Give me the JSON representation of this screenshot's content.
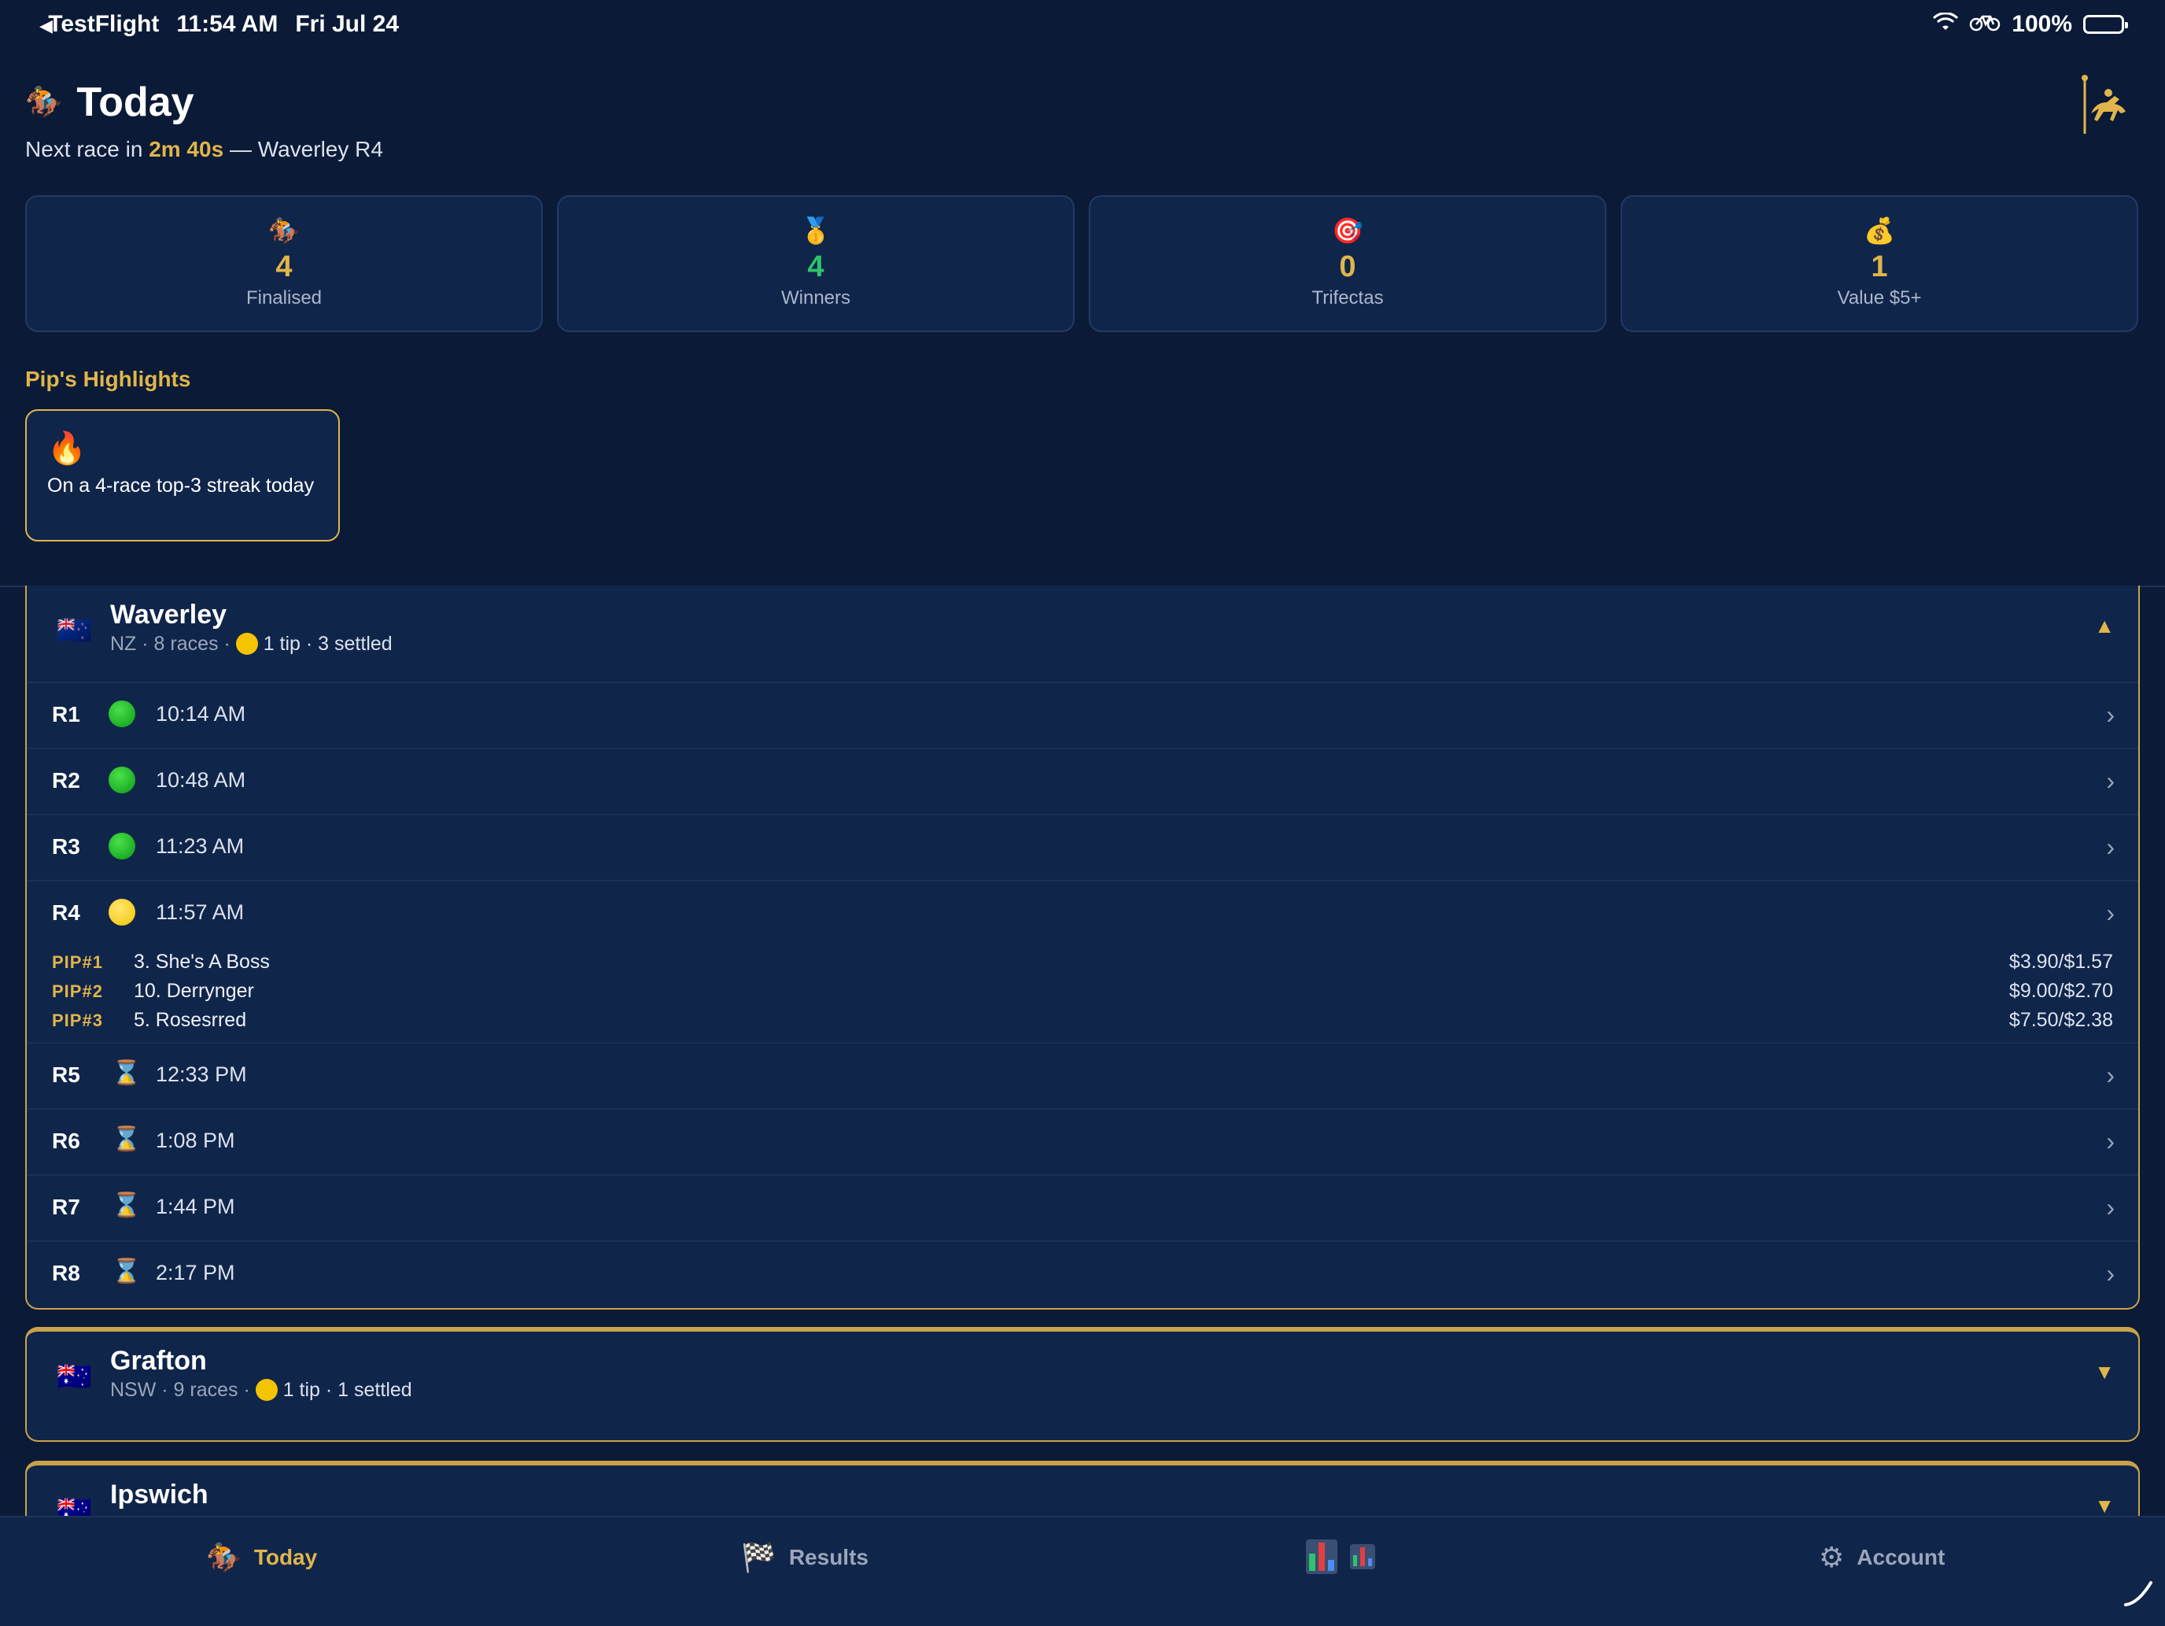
{
  "status_bar": {
    "back_app": "TestFlight",
    "time": "11:54 AM",
    "date": "Fri Jul 24",
    "battery": "100%"
  },
  "header": {
    "title": "Today",
    "subtitle_prefix": "Next race in",
    "countdown": "2m 40s",
    "subtitle_suffix": "— Waverley R4"
  },
  "stats": [
    {
      "icon": "🏇",
      "value": "4",
      "label": "Finalised",
      "color": "#e0b54b"
    },
    {
      "icon": "🥇",
      "value": "4",
      "label": "Winners",
      "color": "#2ec46a"
    },
    {
      "icon": "🎯",
      "value": "0",
      "label": "Trifectas",
      "color": "#e0b54b"
    },
    {
      "icon": "💰",
      "value": "1",
      "label": "Value $5+",
      "color": "#e0b54b"
    }
  ],
  "highlights": {
    "title": "Pip's Highlights",
    "items": [
      {
        "icon": "🔥",
        "text": "On a 4-race top-3 streak today"
      }
    ]
  },
  "venues": [
    {
      "name": "Waverley",
      "flag": "🇳🇿",
      "meta_prefix": "NZ · 8 races ·",
      "tip_text": "1 tip · 3 settled",
      "expanded": true,
      "races": [
        {
          "num": "R1",
          "status": "green",
          "time": "10:14 AM"
        },
        {
          "num": "R2",
          "status": "green",
          "time": "10:48 AM"
        },
        {
          "num": "R3",
          "status": "green",
          "time": "11:23 AM"
        },
        {
          "num": "R4",
          "status": "yellow",
          "time": "11:57 AM",
          "tips": [
            {
              "rank": "PIP#1",
              "runner": "3. She's A Boss",
              "odds": "$3.90/$1.57"
            },
            {
              "rank": "PIP#2",
              "runner": "10. Derrynger",
              "odds": "$9.00/$2.70"
            },
            {
              "rank": "PIP#3",
              "runner": "5. Rosesrred",
              "odds": "$7.50/$2.38"
            }
          ]
        },
        {
          "num": "R5",
          "status": "hourglass",
          "time": "12:33 PM"
        },
        {
          "num": "R6",
          "status": "hourglass",
          "time": "1:08 PM"
        },
        {
          "num": "R7",
          "status": "hourglass",
          "time": "1:44 PM"
        },
        {
          "num": "R8",
          "status": "hourglass",
          "time": "2:17 PM"
        }
      ]
    },
    {
      "name": "Grafton",
      "flag": "🇦🇺",
      "meta_prefix": "NSW · 9 races ·",
      "tip_text": "1 tip · 1 settled",
      "expanded": false
    },
    {
      "name": "Ipswich",
      "flag": "🇦🇺",
      "expanded": false
    }
  ],
  "tabbar": {
    "today": "Today",
    "results": "Results",
    "account": "Account"
  },
  "colors": {
    "background": "#0b1a36",
    "card": "#10254a",
    "accent_gold": "#e0b54b",
    "win_green": "#2ec46a"
  }
}
